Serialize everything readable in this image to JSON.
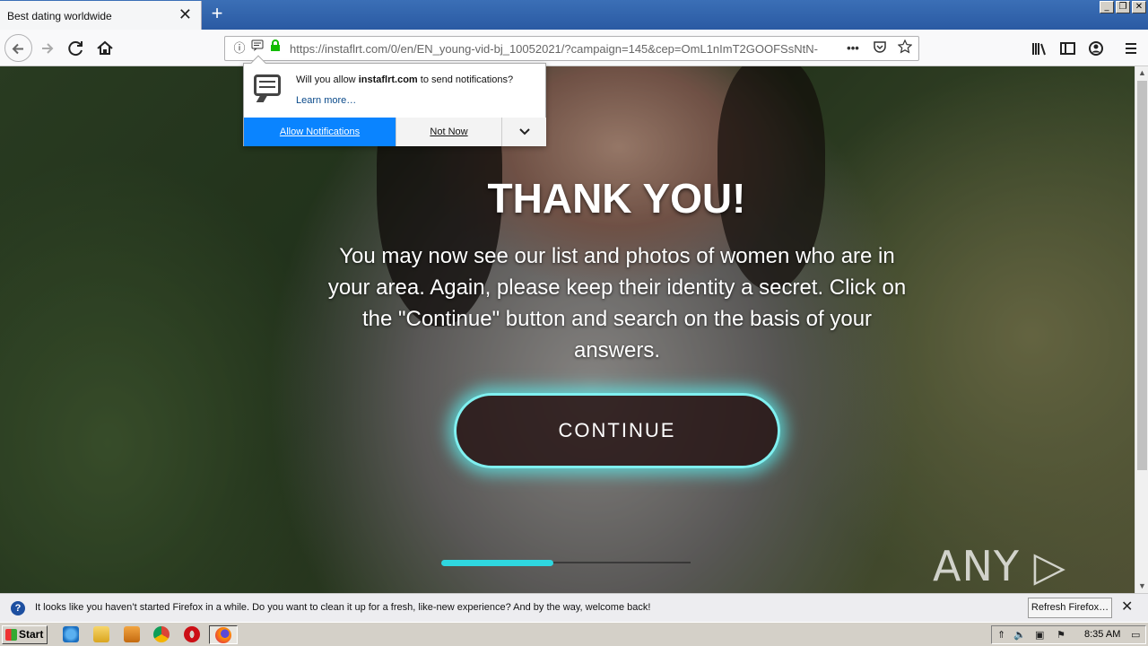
{
  "browser": {
    "tab_title": "Best dating worldwide",
    "tab_close": "✕",
    "new_tab": "+",
    "window_buttons": [
      "_",
      "❐",
      "✕"
    ],
    "url": "https://instaflrt.com/0/en/EN_young-vid-bj_10052021/?campaign=145&cep=OmL1nImT2GOOFSsNtN-",
    "url_more": "•••"
  },
  "notification_popup": {
    "message_prefix": "Will you allow ",
    "site": "instaflrt.com",
    "message_suffix": " to send notifications?",
    "learn_more": "Learn more…",
    "allow_label": "Allow Notifications",
    "not_now_label": "Not Now",
    "more_icon": "chevron-down-icon"
  },
  "page": {
    "headline": "THANK YOU!",
    "body": "You may now see our list and photos of women who are in your area. Again, please keep their identity a secret. Click on the \"Continue\" button and search on the basis of your answers.",
    "continue_label": "CONTINUE",
    "progress": 0.45,
    "watermark": "ANY ▷ RUN"
  },
  "infobar": {
    "message": "It looks like you haven’t started Firefox in a while. Do you want to clean it up for a fresh, like-new experience? And by the way, welcome back!",
    "refresh_label": "Refresh Firefox…",
    "close": "✕"
  },
  "taskbar": {
    "start_label": "Start",
    "time": "8:35 AM"
  },
  "colors": {
    "accent": "#0a84ff",
    "glow": "#2fd7e0",
    "titlebar": "#2a5aa3"
  }
}
